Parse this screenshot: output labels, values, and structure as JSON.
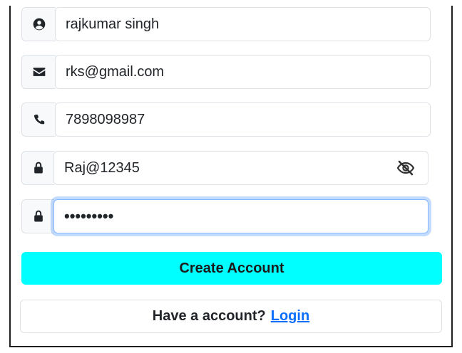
{
  "form": {
    "name_value": "rajkumar singh",
    "email_value": "rks@gmail.com",
    "phone_value": "7898098987",
    "password_value": "Raj@12345",
    "confirm_password_value": "•••••••••"
  },
  "actions": {
    "create_label": "Create Account",
    "have_account_text": "Have a account?",
    "login_label": "Login"
  },
  "colors": {
    "create_button_bg": "#00ffff",
    "link": "#0d6efd",
    "focus_ring": "#86b7fe"
  },
  "icons": {
    "name": "user-circle-icon",
    "email": "envelope-icon",
    "phone": "phone-icon",
    "password": "lock-icon",
    "confirm": "lock-icon",
    "toggle": "eye-slash-icon"
  }
}
